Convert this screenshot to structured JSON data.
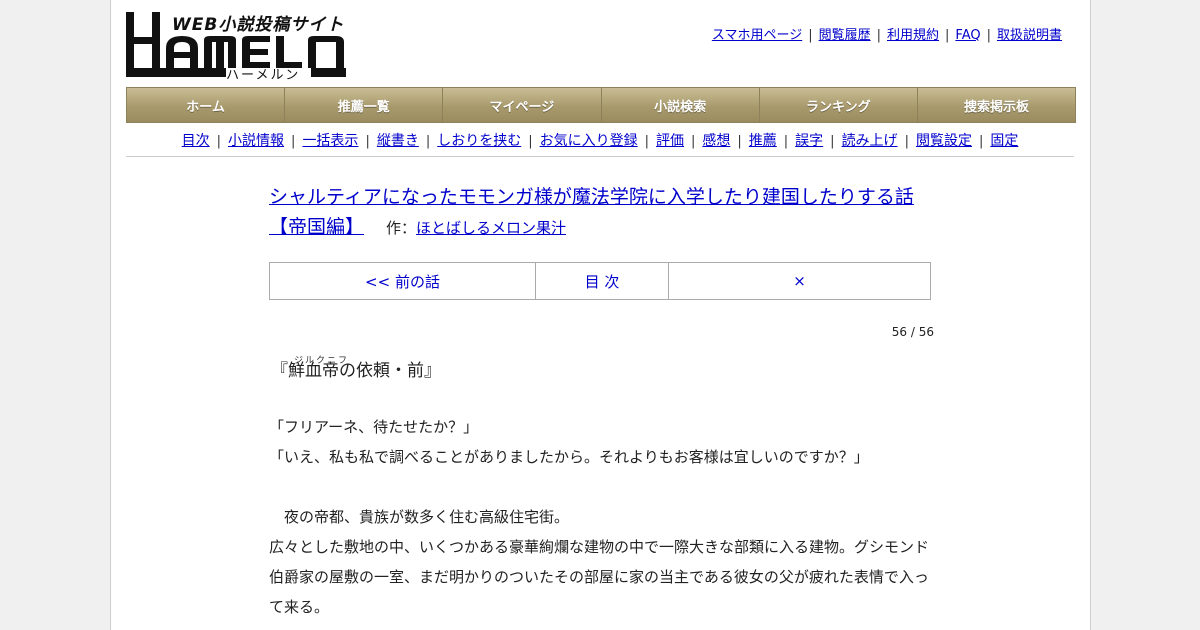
{
  "logo": {
    "wordmark": "HAMELN",
    "sub": "WEB小説投稿サイト",
    "kana": "ハーメルン"
  },
  "toplinks": [
    "スマホ用ページ",
    "閲覧履歴",
    "利用規約",
    "FAQ",
    "取扱説明書"
  ],
  "gnav": [
    "ホーム",
    "推薦一覧",
    "マイページ",
    "小説検索",
    "ランキング",
    "捜索掲示板"
  ],
  "subnav": [
    "目次",
    "小説情報",
    "一括表示",
    "縦書き",
    "しおりを挟む",
    "お気に入り登録",
    "評価",
    "感想",
    "推薦",
    "誤字",
    "読み上げ",
    "閲覧設定",
    "固定"
  ],
  "novel": {
    "title": "シャルティアになったモモンガ様が魔法学院に入学したり建国したりする話【帝国編】",
    "author_prefix": "作：",
    "author": "ほとばしるメロン果汁"
  },
  "chapnav": {
    "prev": "<< 前の話",
    "toc": "目 次",
    "close": "×"
  },
  "page_number": "56 / 56",
  "chapter": {
    "title_open": "『",
    "title_main": "鮮血帝",
    "title_ruby": "ジルクニフ",
    "title_rest": "の依頼・前』"
  },
  "body": [
    "「フリアーネ、待たせたか？」",
    "「いえ、私も私で調べることがありましたから。それよりもお客様は宜しいのですか？」",
    "",
    "　夜の帝都、貴族が数多く住む高級住宅街。",
    "広々とした敷地の中、いくつかある豪華絢爛な建物の中で一際大きな部類に入る建物。グシモンド伯爵家の屋敷の一室、まだ明かりのついたその部屋に家の当主である彼女の父が疲れた表情で入って来る。"
  ]
}
